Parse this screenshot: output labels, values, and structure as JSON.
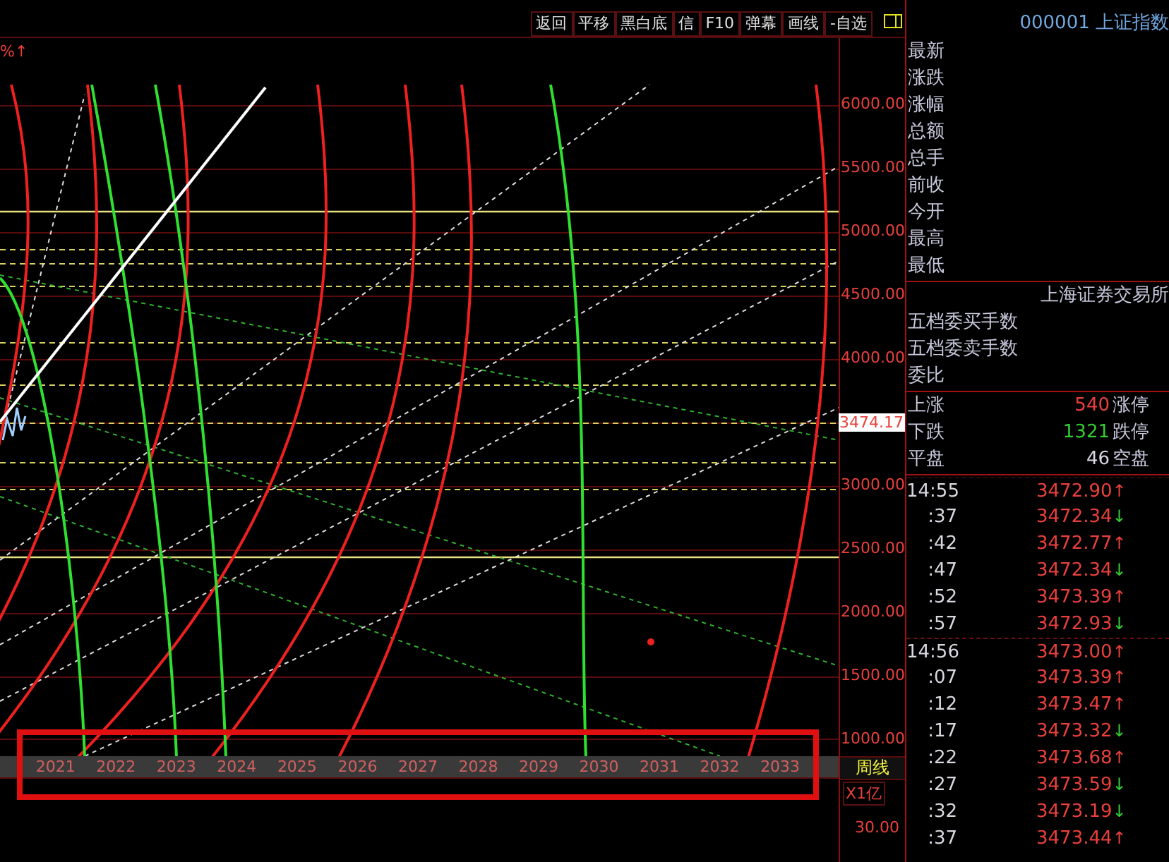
{
  "toolbar": {
    "buttons": [
      "返回",
      "平移",
      "黑白底",
      "信",
      "F10",
      "弹幕",
      "画线",
      "-自选"
    ]
  },
  "security": {
    "code": "000001",
    "name": "上证指数"
  },
  "chart": {
    "corner_label": "%↑",
    "price_axis": [
      "6000.00",
      "5500.00",
      "5000.00",
      "4500.00",
      "4000.00",
      "3000.00",
      "2500.00",
      "2000.00",
      "1500.00",
      "1000.00"
    ],
    "current_price": "3474.17",
    "years": [
      "2021",
      "2022",
      "2023",
      "2024",
      "2025",
      "2026",
      "2027",
      "2028",
      "2029",
      "2030",
      "2031",
      "2032",
      "2033"
    ],
    "period": "周线",
    "volume_unit": "X1亿",
    "volume_axis": [
      "30.00"
    ]
  },
  "quote_fields": [
    "最新",
    "涨跌",
    "涨幅",
    "总额",
    "总手",
    "前收",
    "今开",
    "最高",
    "最低"
  ],
  "exchange": "上海证券交易所",
  "order_fields": [
    "五档委买手数",
    "五档委卖手数",
    "委比"
  ],
  "breadth": [
    {
      "label": "上涨",
      "value": "540",
      "limit_label": "涨停",
      "kind": "up"
    },
    {
      "label": "下跌",
      "value": "1321",
      "limit_label": "跌停",
      "kind": "down"
    },
    {
      "label": "平盘",
      "value": "46",
      "limit_label": "空盘",
      "kind": "flat"
    }
  ],
  "ticks": [
    {
      "time": "14:55",
      "price": "3472.90",
      "arrow": "↑",
      "kind": "up",
      "minute_start": true
    },
    {
      "time": ":37",
      "price": "3472.34",
      "arrow": "↓",
      "kind": "down",
      "minute_start": false
    },
    {
      "time": ":42",
      "price": "3472.77",
      "arrow": "↑",
      "kind": "up",
      "minute_start": false
    },
    {
      "time": ":47",
      "price": "3472.34",
      "arrow": "↓",
      "kind": "down",
      "minute_start": false
    },
    {
      "time": ":52",
      "price": "3473.39",
      "arrow": "↑",
      "kind": "up",
      "minute_start": false
    },
    {
      "time": ":57",
      "price": "3472.93",
      "arrow": "↓",
      "kind": "down",
      "minute_start": false
    },
    {
      "time": "14:56",
      "price": "3473.00",
      "arrow": "↑",
      "kind": "up",
      "minute_start": true
    },
    {
      "time": ":07",
      "price": "3473.39",
      "arrow": "↑",
      "kind": "up",
      "minute_start": false
    },
    {
      "time": ":12",
      "price": "3473.47",
      "arrow": "↑",
      "kind": "up",
      "minute_start": false
    },
    {
      "time": ":17",
      "price": "3473.32",
      "arrow": "↓",
      "kind": "down",
      "minute_start": false
    },
    {
      "time": ":22",
      "price": "3473.68",
      "arrow": "↑",
      "kind": "up",
      "minute_start": false
    },
    {
      "time": ":27",
      "price": "3473.59",
      "arrow": "↓",
      "kind": "down",
      "minute_start": false
    },
    {
      "time": ":32",
      "price": "3473.19",
      "arrow": "↓",
      "kind": "down",
      "minute_start": false
    },
    {
      "time": ":37",
      "price": "3473.44",
      "arrow": "↑",
      "kind": "up",
      "minute_start": false
    }
  ]
}
